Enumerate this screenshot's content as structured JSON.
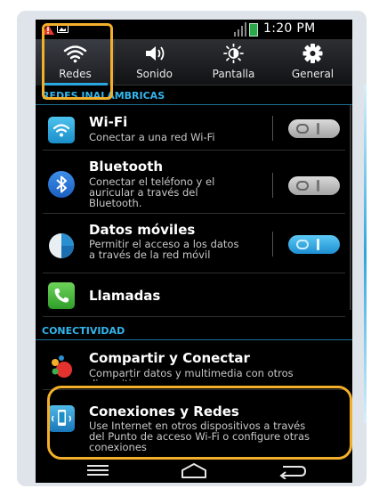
{
  "status_bar": {
    "time": "1:20 PM",
    "icons": [
      "warning-icon",
      "image-icon",
      "signal-icon",
      "battery-icon"
    ]
  },
  "tabs": [
    {
      "label": "Redes",
      "icon": "wifi-icon",
      "active": true
    },
    {
      "label": "Sonido",
      "icon": "speaker-icon",
      "active": false
    },
    {
      "label": "Pantalla",
      "icon": "brightness-icon",
      "active": false
    },
    {
      "label": "General",
      "icon": "gear-icon",
      "active": false
    }
  ],
  "sections": {
    "wireless": {
      "header": "REDES INALÁMBRICAS"
    },
    "connectivity": {
      "header": "CONECTIVIDAD"
    }
  },
  "items": [
    {
      "title": "Wi-Fi",
      "desc": [
        "Conectar a una red Wi-Fi"
      ],
      "toggle": "off",
      "icon": "wifi-icon"
    },
    {
      "title": "Bluetooth",
      "desc": [
        "Conectar el teléfono y el",
        "auricular a través del",
        "Bluetooth."
      ],
      "toggle": "off",
      "icon": "bluetooth-icon"
    },
    {
      "title": "Datos móviles",
      "desc": [
        "Permitir el acceso a los datos",
        "a través de la red móvil"
      ],
      "toggle": "on",
      "icon": "mobile-data-icon"
    },
    {
      "title": "Llamadas",
      "desc": [],
      "icon": "phone-icon"
    },
    {
      "title": "Compartir y Conectar",
      "desc": [
        "Compartir datos y multimedia con otros",
        "dispositivos"
      ],
      "icon": "share-connect-icon"
    },
    {
      "title": "Conexiones y Redes",
      "desc": [
        "Use Internet en otros dispositivos a través",
        "del Punto de acceso Wi-Fi o configure otras",
        "conexiones"
      ],
      "icon": "tethering-icon"
    }
  ],
  "nav": {
    "icons": [
      "menu-icon",
      "home-icon",
      "back-icon"
    ]
  },
  "colors": {
    "accent": "#29a8df",
    "highlight": "#f2b02a",
    "background": "#000000",
    "section_text": "#32b5ec"
  }
}
